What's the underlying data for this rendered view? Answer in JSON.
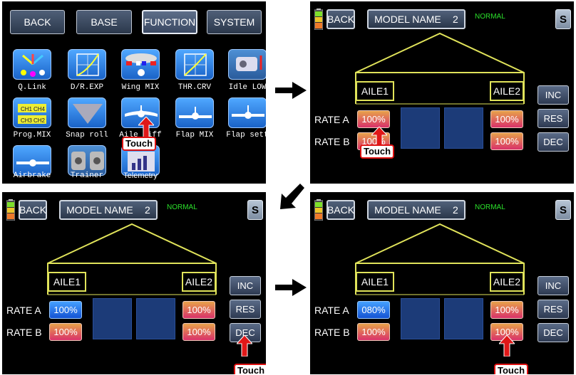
{
  "screen1": {
    "tabs": [
      "BACK",
      "BASE",
      "FUNCTION",
      "SYSTEM"
    ],
    "tiles": [
      {
        "label": "Q.Link",
        "icon": "q-link-icon"
      },
      {
        "label": "D/R.EXP",
        "icon": "dr-exp-curve-icon"
      },
      {
        "label": "Wing MIX",
        "icon": "wing-mix-icon"
      },
      {
        "label": "THR.CRV",
        "icon": "thr-curve-icon"
      },
      {
        "label": "Idle LOW",
        "icon": "idle-low-icon"
      },
      {
        "label": "Prog.MIX",
        "icon": "prog-mix-icon"
      },
      {
        "label": "Snap roll",
        "icon": "snap-roll-icon"
      },
      {
        "label": "Aile diff",
        "icon": "aileron-differential-icon"
      },
      {
        "label": "Flap MIX",
        "icon": "flap-mix-icon"
      },
      {
        "label": "Flap sett",
        "icon": "flap-setting-icon"
      },
      {
        "label": "Airbrake",
        "icon": "airbrake-icon"
      },
      {
        "label": "Trainer",
        "icon": "trainer-icon"
      },
      {
        "label": "Telemetry",
        "icon": "telemetry-icon"
      }
    ],
    "touch": "Touch"
  },
  "aileron": {
    "back": "BACK",
    "model_name": "MODEL NAME",
    "model_number": "2",
    "mode": "NORMAL",
    "s_button": "S",
    "aile1": "AILE1",
    "aile2": "AILE2",
    "inc": "INC",
    "res": "RES",
    "dec": "DEC",
    "rate_a": "RATE A",
    "rate_b": "RATE B",
    "touch": "Touch",
    "colors": {
      "normal_text": "#2be02b",
      "outline": "#e0e35a"
    }
  },
  "screen2": {
    "rate_a_left": "100%",
    "rate_a_right": "100%",
    "rate_b_left": "100%",
    "rate_b_right": "100%"
  },
  "screen3": {
    "rate_a_left": "100%",
    "rate_a_right": "100%",
    "rate_b_left": "100%",
    "rate_b_right": "100%"
  },
  "screen4": {
    "rate_a_left": "080%",
    "rate_a_right": "100%",
    "rate_b_left": "100%",
    "rate_b_right": "100%"
  }
}
